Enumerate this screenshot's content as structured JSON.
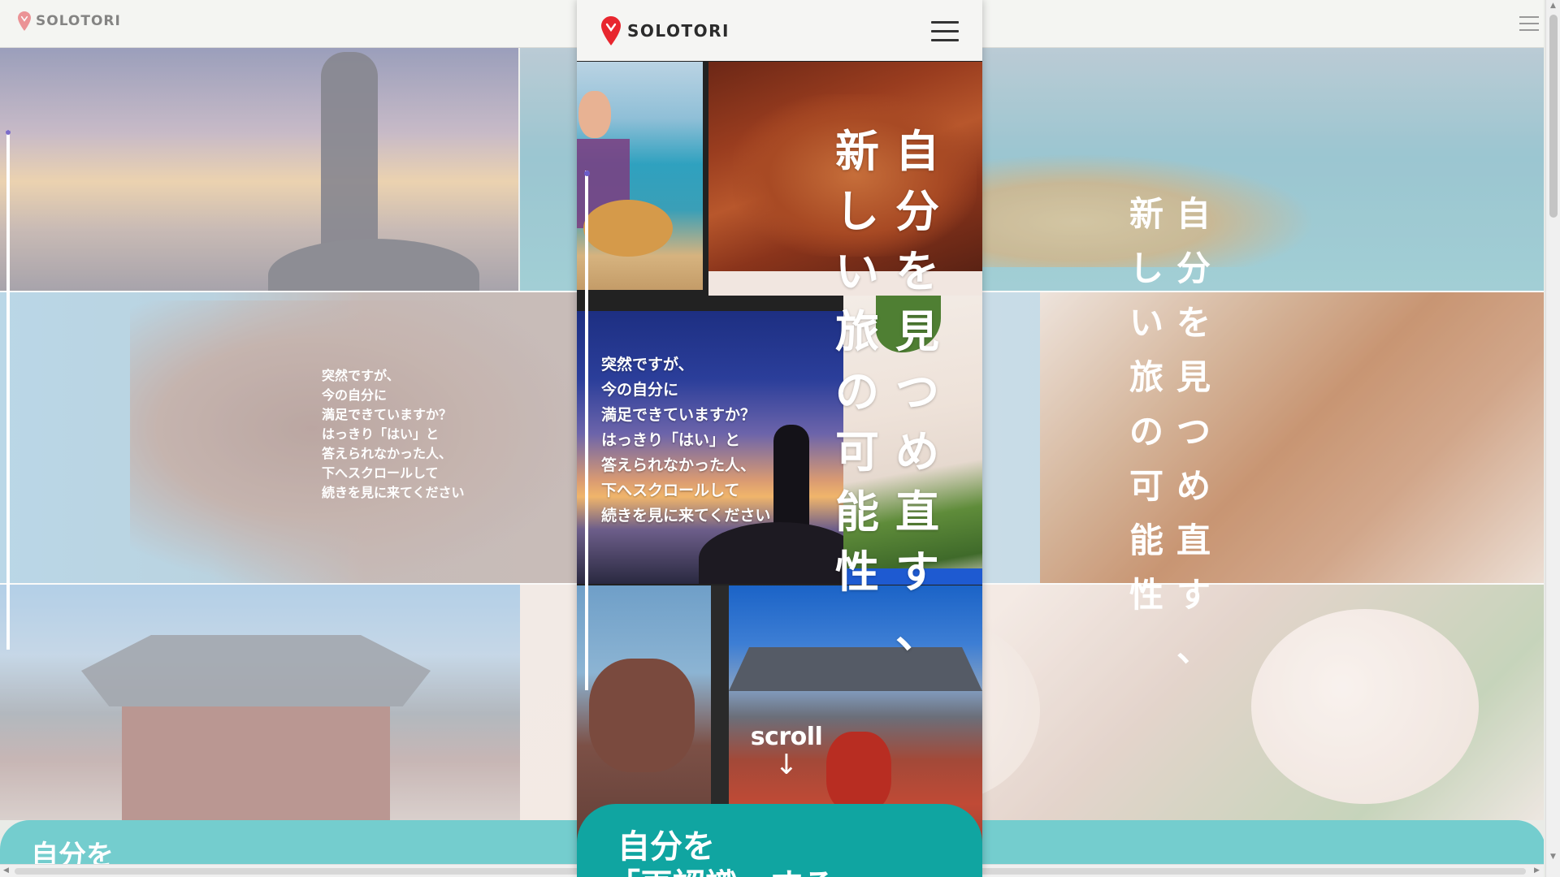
{
  "brand": {
    "name": "SOLOTORI",
    "pin_color": "#e8262e"
  },
  "intro": {
    "lines": [
      "突然ですが、",
      "今の自分に",
      "満足できていますか？",
      "はっきり「はい」と",
      "答えられなかった人、",
      "下へスクロールして",
      "続きを見に来てください"
    ]
  },
  "tagline": {
    "column_right": [
      "自",
      "分",
      "を",
      "見",
      "つ",
      "め",
      "直",
      "す",
      "、"
    ],
    "column_left": [
      "新",
      "し",
      "い",
      "旅",
      "の",
      "可",
      "能",
      "性"
    ]
  },
  "scroll_cue": {
    "label": "scroll",
    "arrow": "↓"
  },
  "section": {
    "heading_line1": "自分を",
    "heading_line2": "「再認識」する",
    "band_color": "#10a5a1"
  },
  "icons": {
    "logo": "map-pin-icon",
    "menu": "hamburger-menu-icon",
    "scroll": "arrow-down-icon"
  }
}
